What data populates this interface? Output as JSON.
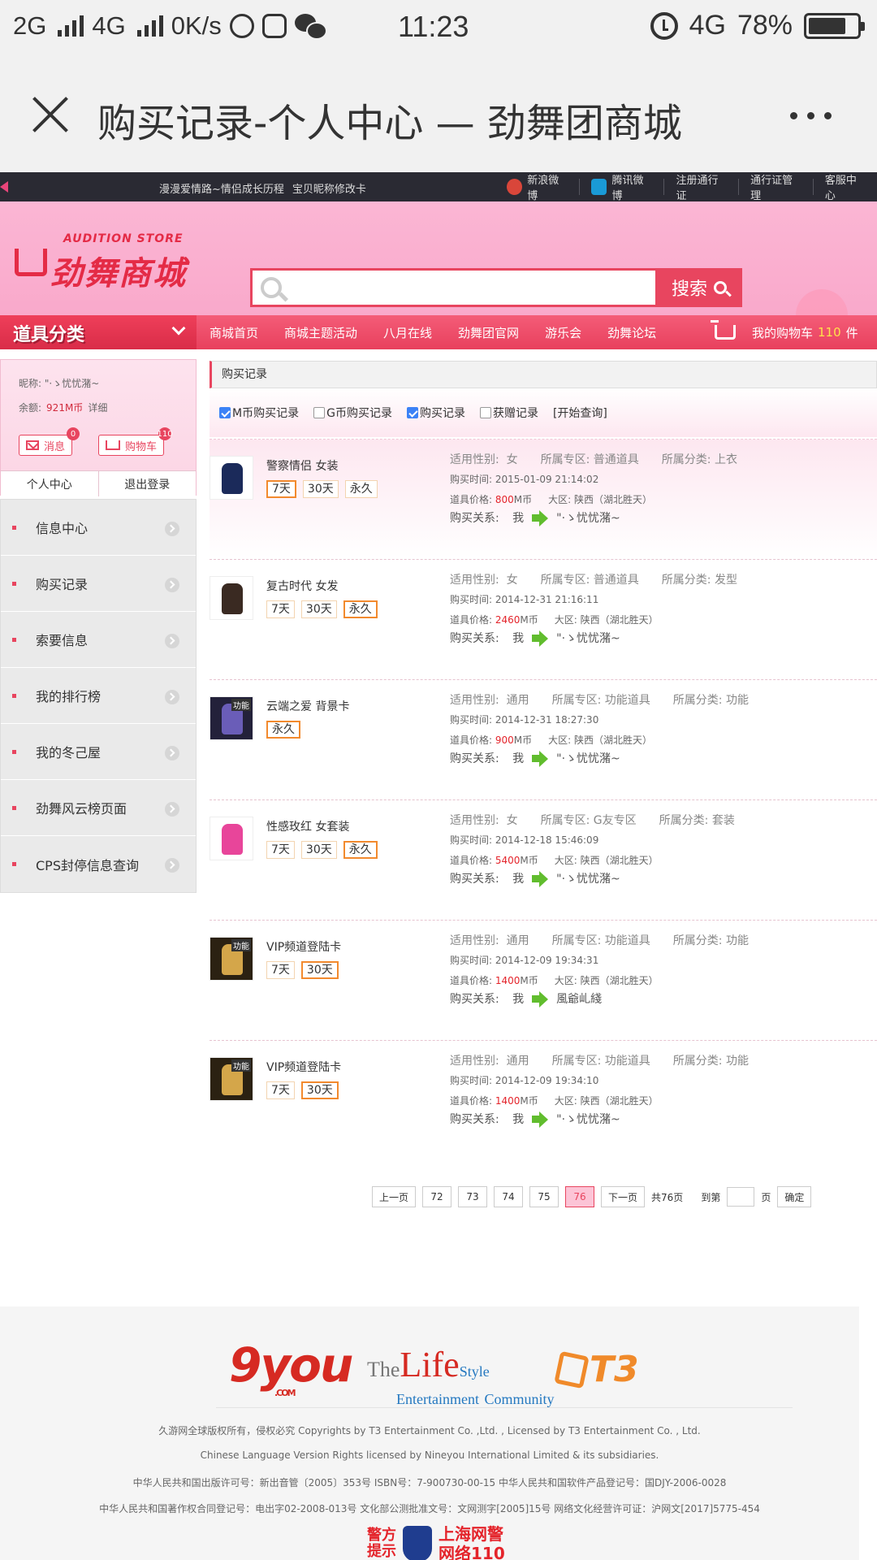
{
  "status_bar": {
    "network1": "2G",
    "network2": "4G",
    "speed": "0K/s",
    "time": "11:23",
    "right_network": "4G",
    "battery": "78%"
  },
  "browser": {
    "title": "购买记录-个人中心 — 劲舞团商城"
  },
  "topnav": {
    "left_links": [
      "漫漫爱情路~情侣成长历程",
      "宝贝昵称修改卡"
    ],
    "right_links": [
      "新浪微博",
      "腾讯微博",
      "注册通行证",
      "通行证管理",
      "客服中心"
    ]
  },
  "header": {
    "logo_en": "AUDITION  STORE",
    "logo_cn": "劲舞商城",
    "search_button": "搜索",
    "search_value": ""
  },
  "catnav": {
    "category_title": "道具分类",
    "items": [
      "商城首页",
      "商城主题活动",
      "八月在线",
      "劲舞团官网",
      "游乐会",
      "劲舞论坛"
    ],
    "cart_label": "我的购物车",
    "cart_count": "110",
    "cart_unit": "件"
  },
  "user": {
    "nick_label": "昵称:",
    "nick": "\"·ゝ忧忧潴~",
    "balance_label": "余额:",
    "balance": "921M币",
    "balance_detail": "详细",
    "msg_label": "消息",
    "msg_count": "0",
    "cart_label": "购物车",
    "cart_count": "110",
    "center": "个人中心",
    "logout": "退出登录"
  },
  "menu": [
    "信息中心",
    "购买记录",
    "索要信息",
    "我的排行榜",
    "我的冬己屋",
    "劲舞风云榜页面",
    "CPS封停信息查询"
  ],
  "main": {
    "crumb": "购买记录",
    "filters": [
      {
        "label": "M币购买记录",
        "checked": true
      },
      {
        "label": "G币购买记录",
        "checked": false
      },
      {
        "label": "购买记录",
        "checked": true
      },
      {
        "label": "获赠记录",
        "checked": false
      }
    ],
    "query": "[开始查询]"
  },
  "records": [
    {
      "name": "警察情侣 女装",
      "durations": [
        "7天",
        "30天",
        "永久"
      ],
      "selected": 0,
      "gender": "女",
      "zone": "普通道具",
      "category": "上衣",
      "time": "2015-01-09 21:14:02",
      "price": "800",
      "server": "陕西（湖北胜天）",
      "relation_to": "\"·ゝ忧忧潴~",
      "thumb": "navy"
    },
    {
      "name": "复古时代 女发",
      "durations": [
        "7天",
        "30天",
        "永久"
      ],
      "selected": 2,
      "gender": "女",
      "zone": "普通道具",
      "category": "发型",
      "time": "2014-12-31 21:16:11",
      "price": "2460",
      "server": "陕西（湖北胜天）",
      "relation_to": "\"·ゝ忧忧潴~",
      "thumb": "hair"
    },
    {
      "name": "云端之爱 背景卡",
      "durations": [
        "永久"
      ],
      "selected": 0,
      "gender": "通用",
      "zone": "功能道具",
      "category": "功能",
      "time": "2014-12-31 18:27:30",
      "price": "900",
      "server": "陕西（湖北胜天）",
      "relation_to": "\"·ゝ忧忧潴~",
      "thumb": "card"
    },
    {
      "name": "性感玫红 女套装",
      "durations": [
        "7天",
        "30天",
        "永久"
      ],
      "selected": 2,
      "gender": "女",
      "zone": "G友专区",
      "category": "套装",
      "time": "2014-12-18 15:46:09",
      "price": "5400",
      "server": "陕西（湖北胜天）",
      "relation_to": "\"·ゝ忧忧潴~",
      "thumb": "pink"
    },
    {
      "name": "VIP频道登陆卡",
      "durations": [
        "7天",
        "30天"
      ],
      "selected": 1,
      "gender": "通用",
      "zone": "功能道具",
      "category": "功能",
      "time": "2014-12-09 19:34:31",
      "price": "1400",
      "server": "陕西（湖北胜天）",
      "relation_to": "風爺乢綫",
      "thumb": "vip"
    },
    {
      "name": "VIP频道登陆卡",
      "durations": [
        "7天",
        "30天"
      ],
      "selected": 1,
      "gender": "通用",
      "zone": "功能道具",
      "category": "功能",
      "time": "2014-12-09 19:34:10",
      "price": "1400",
      "server": "陕西（湖北胜天）",
      "relation_to": "\"·ゝ忧忧潴~",
      "thumb": "vip"
    }
  ],
  "labels": {
    "gender": "适用性别:",
    "zone": "所属专区:",
    "category": "所属分类:",
    "time": "购买时间:",
    "price": "道具价格:",
    "price_unit": "M币",
    "server": "大区:",
    "relation": "购买关系:",
    "me": "我",
    "func_tag": "功能"
  },
  "pager": {
    "prev": "上一页",
    "pages": [
      "72",
      "73",
      "74",
      "75",
      "76"
    ],
    "current": "76",
    "next": "下一页",
    "total": "共76页",
    "goto": "到第",
    "page_unit": "页",
    "confirm": "确定"
  },
  "footer": {
    "logo_9you": "9you",
    "logo_9you_sub": ".COM",
    "logo_life_1": "The",
    "logo_life_2": "Life",
    "logo_life_3": "Style",
    "logo_life_4": "Entertainment",
    "logo_life_5": "Community",
    "logo_t3": "T3",
    "lines": [
      "久游网全球版权所有，侵权必究 Copyrights by T3 Entertainment Co. ,Ltd. , Licensed by T3 Entertainment Co. , Ltd.",
      "Chinese Language Version Rights licensed by Nineyou International Limited & its subsidiaries.",
      "中华人民共和国出版许可号：新出音管〔2005〕353号 ISBN号：7-900730-00-15 中华人民共和国软件产品登记号：国DJY-2006-0028",
      "中华人民共和国著作权合同登记号：电出字02-2008-013号 文化部公测批准文号：文网测字[2005]15号 网络文化经营许可证：沪网文[2017]5775-454"
    ],
    "police_l": "警方\n提示",
    "police_r": "上海网警\n网络110"
  }
}
